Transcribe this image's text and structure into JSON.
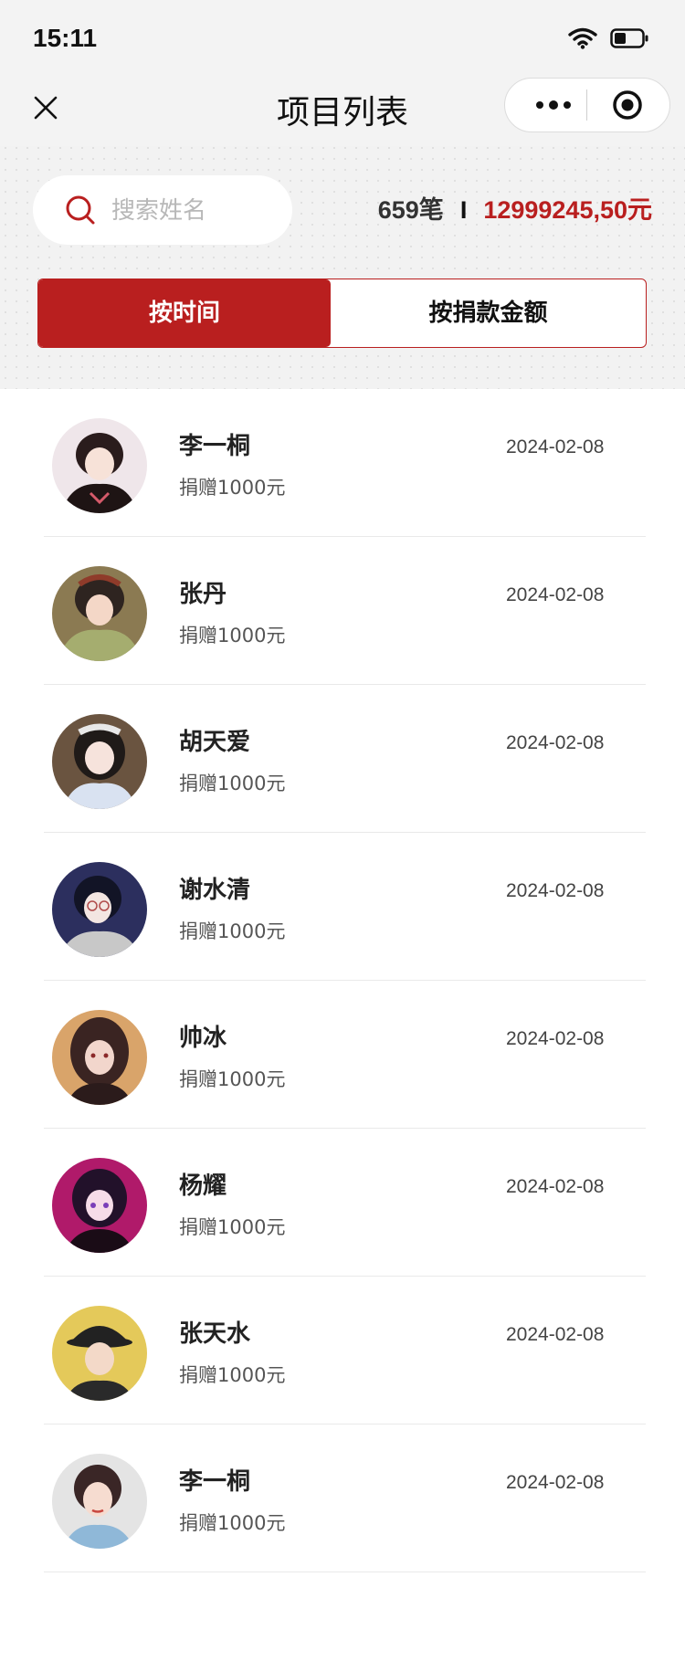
{
  "status_bar": {
    "time": "15:11"
  },
  "nav": {
    "title": "项目列表"
  },
  "search": {
    "placeholder": "搜索姓名",
    "value": ""
  },
  "stats": {
    "count": "659笔",
    "separator": "I",
    "amount": "12999245,50元"
  },
  "tabs": [
    {
      "label": "按时间",
      "active": true
    },
    {
      "label": "按捐款金额",
      "active": false
    }
  ],
  "donors": [
    {
      "name": "李一桐",
      "donation": "捐赠1000元",
      "date": "2024-02-08"
    },
    {
      "name": "张丹",
      "donation": "捐赠1000元",
      "date": "2024-02-08"
    },
    {
      "name": "胡天爱",
      "donation": "捐赠1000元",
      "date": "2024-02-08"
    },
    {
      "name": "谢水清",
      "donation": "捐赠1000元",
      "date": "2024-02-08"
    },
    {
      "name": "帅冰",
      "donation": "捐赠1000元",
      "date": "2024-02-08"
    },
    {
      "name": "杨耀",
      "donation": "捐赠1000元",
      "date": "2024-02-08"
    },
    {
      "name": "张天水",
      "donation": "捐赠1000元",
      "date": "2024-02-08"
    },
    {
      "name": "李一桐",
      "donation": "捐赠1000元",
      "date": "2024-02-08"
    }
  ],
  "colors": {
    "accent": "#b91f1f",
    "background": "#f2f2f2"
  }
}
